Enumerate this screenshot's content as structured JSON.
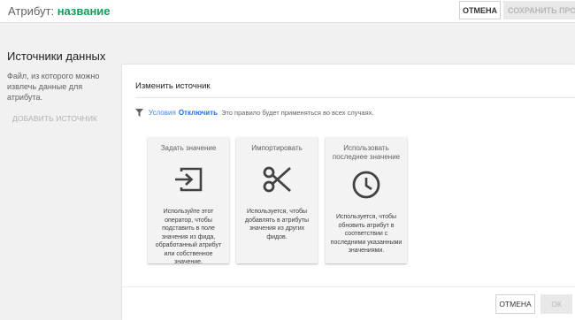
{
  "header": {
    "title_prefix": "Атрибут:",
    "title_name": "название",
    "cancel_label": "ОТМЕНА",
    "save_label": "СОХРАНИТЬ ПРОЕ"
  },
  "sidebar": {
    "section_title": "Источники данных",
    "description": "Файл, из которого можно извлечь данные для атрибута.",
    "add_source_label": "ДОБАВИТЬ ИСТОЧНИК"
  },
  "panel": {
    "title": "Изменить источник",
    "condition": {
      "icon": "filter-icon",
      "label": "Условия",
      "disable_label": "Отключить",
      "note": "Это правило будет применяться во всех случаях."
    },
    "cards": [
      {
        "title": "Задать значение",
        "icon": "input-arrow-icon",
        "description": "Используйте этот оператор, чтобы подставить в поле значения из фида, обработанный атрибут или собственное значение."
      },
      {
        "title": "Импортировать",
        "icon": "scissors-icon",
        "description": "Используется, чтобы добавлять в атрибуты значения из других фидов."
      },
      {
        "title": "Использовать последнее значение",
        "icon": "clock-icon",
        "description": "Используется, чтобы обновить атрибут в соответствии с последними указанными значениями."
      }
    ],
    "footer": {
      "cancel_label": "ОТМЕНА",
      "ok_label": "ОК"
    }
  },
  "colors": {
    "attribute_name": "#0f9d58",
    "link": "#1a73e8",
    "icon": "#424242"
  }
}
